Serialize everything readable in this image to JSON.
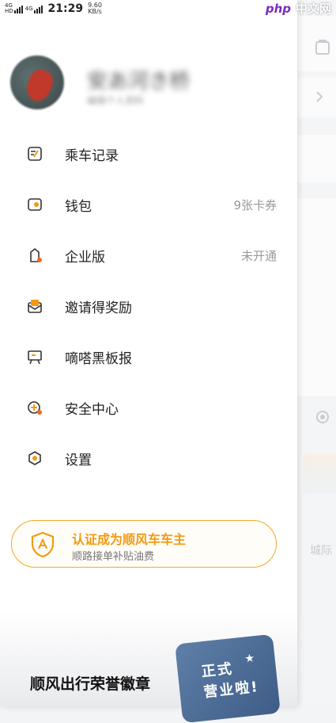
{
  "status_bar": {
    "network": "4G",
    "network_tag": "HD",
    "time": "21:29",
    "speed_value": "9.60",
    "speed_unit": "KB/s"
  },
  "watermark": {
    "php": "php",
    "site": "中文网"
  },
  "profile": {
    "name": "安あ河き桥",
    "subtitle": "编辑个人资料"
  },
  "menu": [
    {
      "label": "乘车记录",
      "value": "",
      "icon": "trip-record-icon"
    },
    {
      "label": "钱包",
      "value": "9张卡券",
      "icon": "wallet-icon"
    },
    {
      "label": "企业版",
      "value": "未开通",
      "icon": "enterprise-icon"
    },
    {
      "label": "邀请得奖励",
      "value": "",
      "icon": "invite-reward-icon"
    },
    {
      "label": "嘀嗒黑板报",
      "value": "",
      "icon": "blackboard-icon"
    },
    {
      "label": "安全中心",
      "value": "",
      "icon": "safety-center-icon"
    },
    {
      "label": "设置",
      "value": "",
      "icon": "settings-icon"
    }
  ],
  "cta": {
    "title": "认证成为顺风车车主",
    "subtitle": "顺路接单补贴油费"
  },
  "badge": {
    "title": "顺风出行荣誉徽章",
    "seal_text": "正式\n营业啦!"
  },
  "background": {
    "peek_text": "城际"
  },
  "colors": {
    "accent": "#f39a12",
    "dot": "#f26522"
  }
}
